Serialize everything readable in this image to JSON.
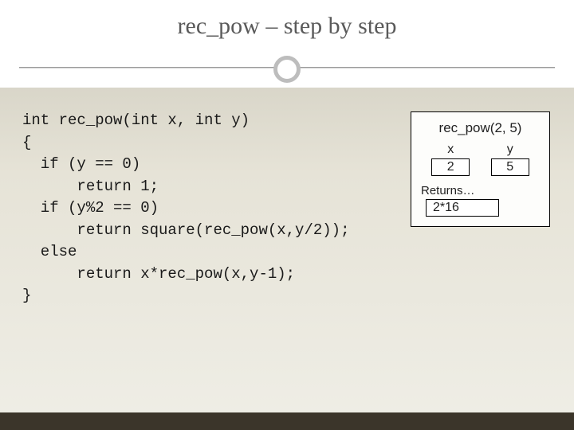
{
  "title": "rec_pow – step by step",
  "code": "int rec_pow(int x, int y)\n{\n  if (y == 0)\n      return 1;\n  if (y%2 == 0)\n      return square(rec_pow(x,y/2));\n  else\n      return x*rec_pow(x,y-1);\n}",
  "trace": {
    "call": "rec_pow(2, 5)",
    "vars": {
      "x_label": "x",
      "x_value": "2",
      "y_label": "y",
      "y_value": "5"
    },
    "returns_label": "Returns…",
    "returns_value": "2*16"
  }
}
